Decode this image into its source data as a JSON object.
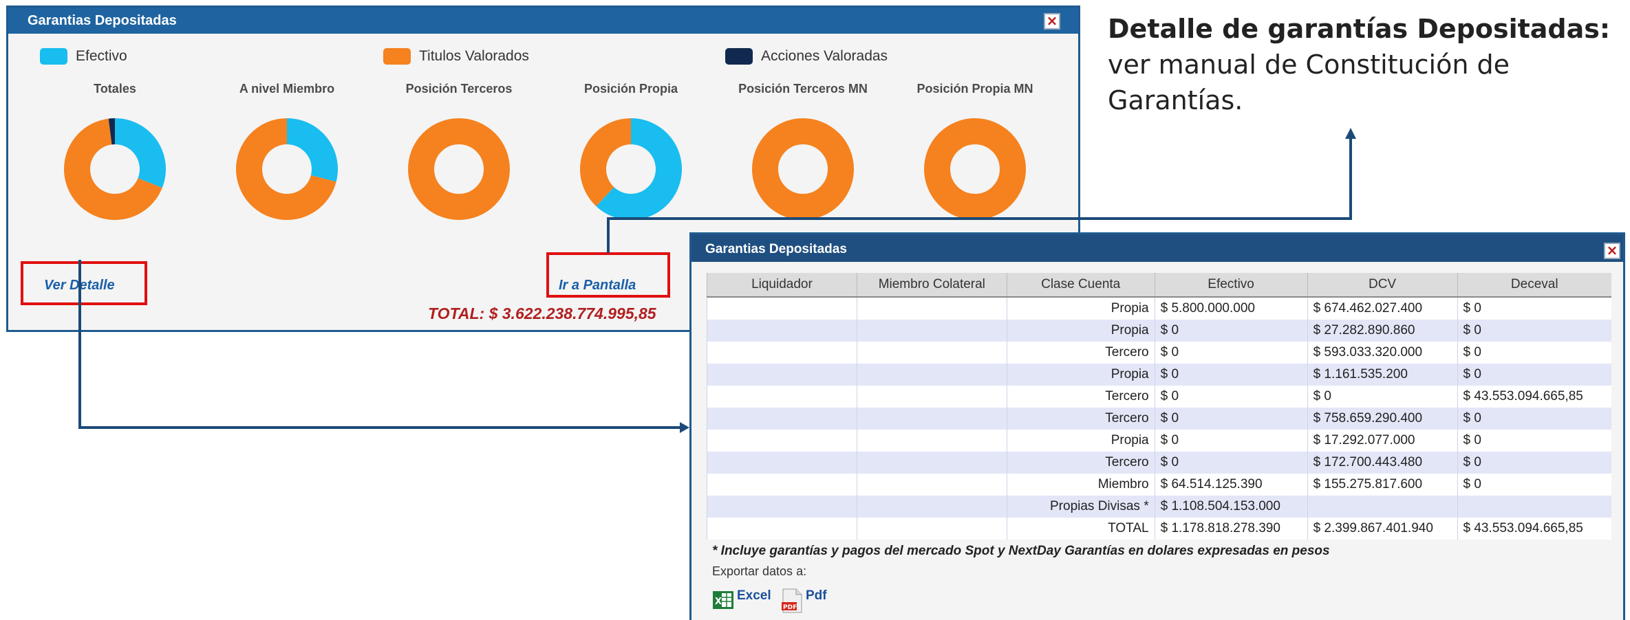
{
  "panel1": {
    "title": "Garantias Depositadas",
    "legend": [
      {
        "label": "Efectivo",
        "color": "#19bdf0"
      },
      {
        "label": "Titulos Valorados",
        "color": "#f5821f"
      },
      {
        "label": "Acciones Valoradas",
        "color": "#12294f"
      }
    ],
    "columns": [
      {
        "title": "Totales",
        "efectivo": 0.31,
        "titulos": 0.67,
        "acciones": 0.02
      },
      {
        "title": "A nivel Miembro",
        "efectivo": 0.29,
        "titulos": 0.71,
        "acciones": 0.0
      },
      {
        "title": "Posición Terceros",
        "efectivo": 0.0,
        "titulos": 1.0,
        "acciones": 0.0
      },
      {
        "title": "Posición Propia",
        "efectivo": 0.62,
        "titulos": 0.38,
        "acciones": 0.0
      },
      {
        "title": "Posición Terceros MN",
        "efectivo": 0.0,
        "titulos": 1.0,
        "acciones": 0.0
      },
      {
        "title": "Posición Propia MN",
        "efectivo": 0.0,
        "titulos": 1.0,
        "acciones": 0.0
      }
    ],
    "ver_detalle": "Ver Detalle",
    "ir_a_pantalla": "Ir a Pantalla",
    "total": "TOTAL:  $ 3.622.238.774.995,85"
  },
  "annotation": {
    "bold": "Detalle de garantías Depositadas:",
    "rest": " ver manual de Constitución de Garantías."
  },
  "panel2": {
    "title": "Garantias Depositadas",
    "headers": [
      "Liquidador",
      "Miembro Colateral",
      "Clase Cuenta",
      "Efectivo",
      "DCV",
      "Deceval"
    ],
    "rows": [
      {
        "liquidador": "",
        "miembro": "",
        "clase": "Propia",
        "efectivo": "$ 5.800.000.000",
        "dcv": "$ 674.462.027.400",
        "deceval": "$ 0"
      },
      {
        "liquidador": "",
        "miembro": "",
        "clase": "Propia",
        "efectivo": "$ 0",
        "dcv": "$ 27.282.890.860",
        "deceval": "$ 0"
      },
      {
        "liquidador": "",
        "miembro": "",
        "clase": "Tercero",
        "efectivo": "$ 0",
        "dcv": "$ 593.033.320.000",
        "deceval": "$ 0"
      },
      {
        "liquidador": "",
        "miembro": "",
        "clase": "Propia",
        "efectivo": "$ 0",
        "dcv": "$ 1.161.535.200",
        "deceval": "$ 0"
      },
      {
        "liquidador": "",
        "miembro": "",
        "clase": "Tercero",
        "efectivo": "$ 0",
        "dcv": "$ 0",
        "deceval": "$ 43.553.094.665,85"
      },
      {
        "liquidador": "",
        "miembro": "",
        "clase": "Tercero",
        "efectivo": "$ 0",
        "dcv": "$ 758.659.290.400",
        "deceval": "$ 0"
      },
      {
        "liquidador": "",
        "miembro": "",
        "clase": "Propia",
        "efectivo": "$ 0",
        "dcv": "$ 17.292.077.000",
        "deceval": "$ 0"
      },
      {
        "liquidador": "",
        "miembro": "",
        "clase": "Tercero",
        "efectivo": "$ 0",
        "dcv": "$ 172.700.443.480",
        "deceval": "$ 0"
      },
      {
        "liquidador": "",
        "miembro": "",
        "clase": "Miembro",
        "efectivo": "$ 64.514.125.390",
        "dcv": "$ 155.275.817.600",
        "deceval": "$ 0"
      },
      {
        "liquidador": "",
        "miembro": "",
        "clase": "Propias Divisas *",
        "efectivo": "$ 1.108.504.153.000",
        "dcv": "",
        "deceval": ""
      },
      {
        "liquidador": "",
        "miembro": "",
        "clase": "TOTAL",
        "efectivo": "$ 1.178.818.278.390",
        "dcv": "$ 2.399.867.401.940",
        "deceval": "$ 43.553.094.665,85"
      }
    ],
    "footnote": "* Incluye garantías y pagos del mercado Spot y NextDay   Garantías en dolares expresadas en pesos",
    "export_label": "Exportar datos a:",
    "excel_label": "Excel",
    "pdf_label": "Pdf",
    "header_color": "#1f4f80"
  }
}
